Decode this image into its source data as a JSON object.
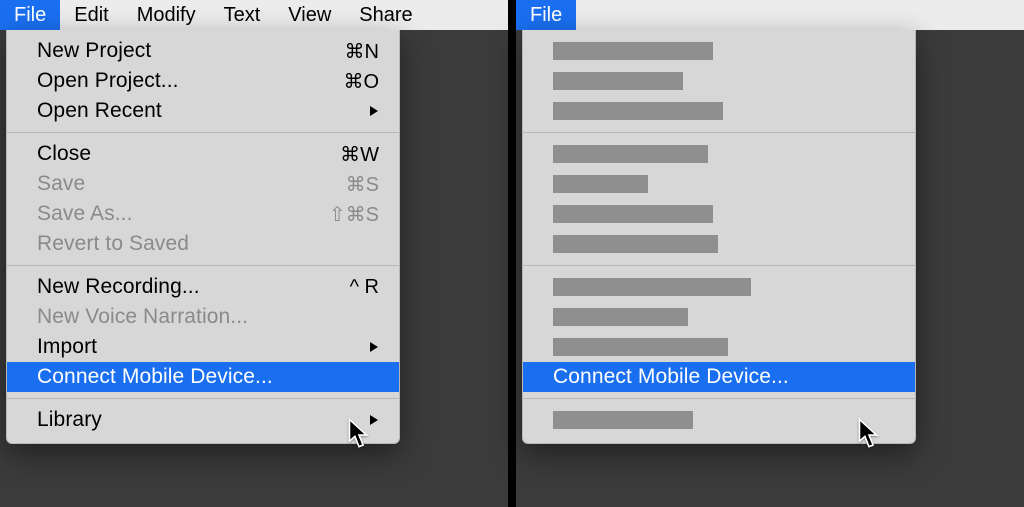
{
  "menubar": {
    "items": [
      {
        "label": "File",
        "active": true
      },
      {
        "label": "Edit",
        "active": false
      },
      {
        "label": "Modify",
        "active": false
      },
      {
        "label": "Text",
        "active": false
      },
      {
        "label": "View",
        "active": false
      },
      {
        "label": "Share",
        "active": false
      }
    ]
  },
  "menu": {
    "groups": [
      [
        {
          "label": "New Project",
          "shortcut": "⌘N",
          "submenu": false,
          "disabled": false,
          "highlight": false
        },
        {
          "label": "Open Project...",
          "shortcut": "⌘O",
          "submenu": false,
          "disabled": false,
          "highlight": false
        },
        {
          "label": "Open Recent",
          "shortcut": "",
          "submenu": true,
          "disabled": false,
          "highlight": false
        }
      ],
      [
        {
          "label": "Close",
          "shortcut": "⌘W",
          "submenu": false,
          "disabled": false,
          "highlight": false
        },
        {
          "label": "Save",
          "shortcut": "⌘S",
          "submenu": false,
          "disabled": true,
          "highlight": false
        },
        {
          "label": "Save As...",
          "shortcut": "⇧⌘S",
          "submenu": false,
          "disabled": true,
          "highlight": false
        },
        {
          "label": "Revert to Saved",
          "shortcut": "",
          "submenu": false,
          "disabled": true,
          "highlight": false
        }
      ],
      [
        {
          "label": "New Recording...",
          "shortcut": "^ R",
          "submenu": false,
          "disabled": false,
          "highlight": false
        },
        {
          "label": "New Voice Narration...",
          "shortcut": "",
          "submenu": false,
          "disabled": true,
          "highlight": false
        },
        {
          "label": "Import",
          "shortcut": "",
          "submenu": true,
          "disabled": false,
          "highlight": false
        },
        {
          "label": "Connect Mobile Device...",
          "shortcut": "",
          "submenu": false,
          "disabled": false,
          "highlight": true
        }
      ],
      [
        {
          "label": "Library",
          "shortcut": "",
          "submenu": true,
          "disabled": false,
          "highlight": false
        }
      ]
    ]
  },
  "right": {
    "menubar_label": "File",
    "highlight_label": "Connect Mobile Device...",
    "placeholders": [
      [
        160,
        130,
        170
      ],
      [
        155,
        95,
        160,
        165
      ],
      [
        198,
        135,
        175
      ],
      [
        140
      ]
    ],
    "highlight_group_index": 2,
    "highlight_after_index": 2
  }
}
